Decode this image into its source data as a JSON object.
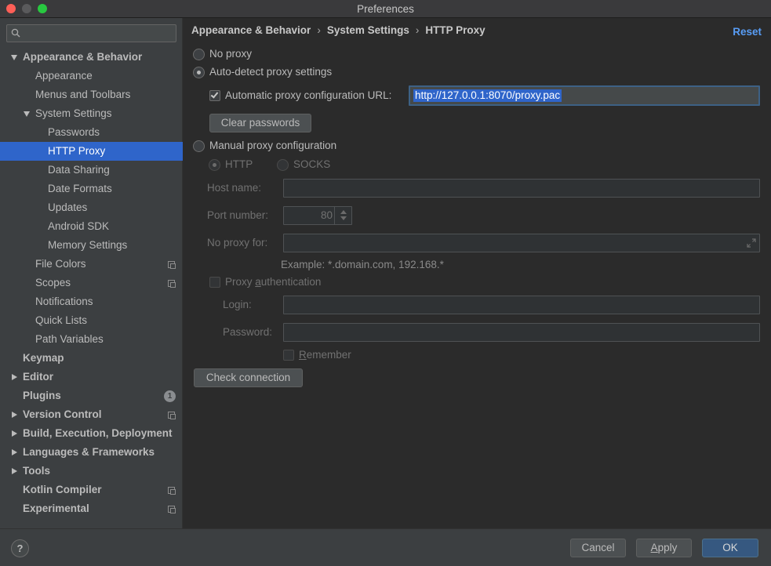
{
  "window": {
    "title": "Preferences"
  },
  "search": {
    "placeholder": ""
  },
  "sidebar": {
    "items": [
      {
        "label": "Appearance & Behavior"
      },
      {
        "label": "Appearance"
      },
      {
        "label": "Menus and Toolbars"
      },
      {
        "label": "System Settings"
      },
      {
        "label": "Passwords"
      },
      {
        "label": "HTTP Proxy"
      },
      {
        "label": "Data Sharing"
      },
      {
        "label": "Date Formats"
      },
      {
        "label": "Updates"
      },
      {
        "label": "Android SDK"
      },
      {
        "label": "Memory Settings"
      },
      {
        "label": "File Colors"
      },
      {
        "label": "Scopes"
      },
      {
        "label": "Notifications"
      },
      {
        "label": "Quick Lists"
      },
      {
        "label": "Path Variables"
      },
      {
        "label": "Keymap"
      },
      {
        "label": "Editor"
      },
      {
        "label": "Plugins",
        "badge": "1"
      },
      {
        "label": "Version Control"
      },
      {
        "label": "Build, Execution, Deployment"
      },
      {
        "label": "Languages & Frameworks"
      },
      {
        "label": "Tools"
      },
      {
        "label": "Kotlin Compiler"
      },
      {
        "label": "Experimental"
      }
    ]
  },
  "breadcrumb": {
    "items": [
      "Appearance & Behavior",
      "System Settings",
      "HTTP Proxy"
    ],
    "separator": "›"
  },
  "reset_label": "Reset",
  "proxy": {
    "no_proxy_label": "No proxy",
    "auto_detect_label": "Auto-detect proxy settings",
    "auto_url_label": "Automatic proxy configuration URL:",
    "auto_url_value": "http://127.0.0.1:8070/proxy.pac",
    "clear_passwords_label": "Clear passwords",
    "manual_label": "Manual proxy configuration",
    "http_label": "HTTP",
    "socks_label": "SOCKS",
    "host_label": "Host name:",
    "host_value": "",
    "port_label": "Port number:",
    "port_value": "80",
    "no_proxy_for_label": "No proxy for:",
    "no_proxy_for_value": "",
    "example_text": "Example: *.domain.com, 192.168.*",
    "auth_label_pre": "Proxy ",
    "auth_label_u": "a",
    "auth_label_post": "uthentication",
    "login_label": "Login:",
    "login_value": "",
    "password_label": "Password:",
    "password_value": "",
    "remember_label_u": "R",
    "remember_label_post": "emember",
    "check_connection_label": "Check connection"
  },
  "footer": {
    "help_label": "?",
    "cancel_label": "Cancel",
    "apply_label_u": "A",
    "apply_label_post": "pply",
    "ok_label": "OK"
  },
  "colors": {
    "selection": "#2f65ca",
    "link": "#589df6",
    "primary_button": "#365880"
  }
}
